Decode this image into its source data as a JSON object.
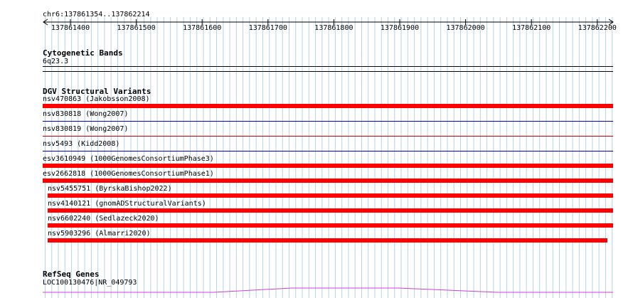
{
  "ruler": {
    "location": "chr6:137861354..137862214",
    "ticks": [
      "137861400",
      "137861500",
      "137861600",
      "137861700",
      "137861800",
      "137861900",
      "137862000",
      "137862100",
      "137862200"
    ]
  },
  "cytoband": {
    "title": "Cytogenetic Bands",
    "label": "6q23.3"
  },
  "dgv": {
    "title": "DGV Structural Variants",
    "variants": [
      {
        "label": "nsv470863 (Jakobsson2008)",
        "style": "thick",
        "color": "#ff0000"
      },
      {
        "label": "nsv830818 (Wong2007)",
        "style": "thin",
        "color": "#0000cc"
      },
      {
        "label": "nsv830819 (Wong2007)",
        "style": "thin",
        "color": "#cc0000"
      },
      {
        "label": "nsv5493 (Kidd2008)",
        "style": "thin",
        "color": "#0000cc"
      },
      {
        "label": "esv3610949 (1000GenomesConsortiumPhase3)",
        "style": "thick",
        "color": "#ff0000"
      },
      {
        "label": "esv2662818 (1000GenomesConsortiumPhase1)",
        "style": "thick",
        "color": "#ff0000"
      },
      {
        "label": "nsv5455751 (ByrskaBishop2022)",
        "style": "thick",
        "color": "#ff0000"
      },
      {
        "label": "nsv4140121 (gnomADStructuralVariants)",
        "style": "thick",
        "color": "#ff0000"
      },
      {
        "label": "nsv6602240 (Sedlazeck2020)",
        "style": "thick",
        "color": "#ff0000"
      },
      {
        "label": "nsv5903296 (Almarri2020)",
        "style": "thick",
        "color": "#ff0000"
      }
    ]
  },
  "refseq": {
    "title": "RefSeq Genes",
    "gene_label": "LOC100130476|NR_049793",
    "color": "#cc44cc"
  }
}
